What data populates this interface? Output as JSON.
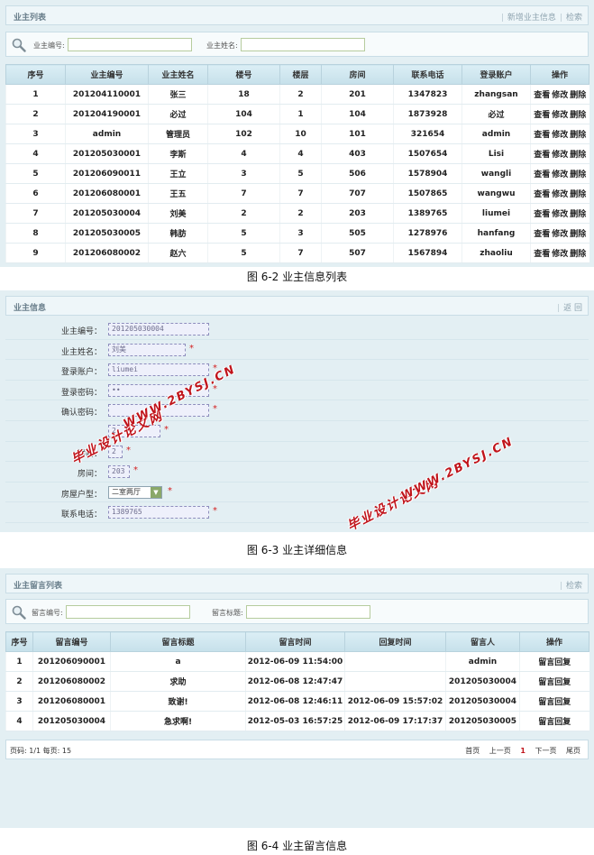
{
  "owner_list": {
    "title": "业主列表",
    "links": [
      "新增业主信息",
      "检索"
    ],
    "search": {
      "label1": "业主编号:",
      "label2": "业主姓名:"
    },
    "columns": [
      "序号",
      "业主编号",
      "业主姓名",
      "楼号",
      "楼层",
      "房间",
      "联系电话",
      "登录账户",
      "操作"
    ],
    "actions": [
      "查看",
      "修改",
      "删除"
    ],
    "rows": [
      [
        "1",
        "201204110001",
        "张三",
        "18",
        "2",
        "201",
        "1347823",
        "zhangsan"
      ],
      [
        "2",
        "201204190001",
        "必过",
        "104",
        "1",
        "104",
        "1873928",
        "必过"
      ],
      [
        "3",
        "admin",
        "管理员",
        "102",
        "10",
        "101",
        "321654",
        "admin"
      ],
      [
        "4",
        "201205030001",
        "李斯",
        "4",
        "4",
        "403",
        "1507654",
        "Lisi"
      ],
      [
        "5",
        "201206090011",
        "王立",
        "3",
        "5",
        "506",
        "1578904",
        "wangli"
      ],
      [
        "6",
        "201206080001",
        "王五",
        "7",
        "7",
        "707",
        "1507865",
        "wangwu"
      ],
      [
        "7",
        "201205030004",
        "刘美",
        "2",
        "2",
        "203",
        "1389765",
        "liumei"
      ],
      [
        "8",
        "201205030005",
        "韩肪",
        "5",
        "3",
        "505",
        "1278976",
        "hanfang"
      ],
      [
        "9",
        "201206080002",
        "赵六",
        "5",
        "7",
        "507",
        "1567894",
        "zhaoliu"
      ]
    ],
    "caption": "图 6-2  业主信息列表"
  },
  "owner_info": {
    "title": "业主信息",
    "back": "返 回",
    "fields": [
      {
        "label": "业主编号：",
        "value": "201205030004",
        "required": false
      },
      {
        "label": "业主姓名：",
        "value": "刘美",
        "required": true
      },
      {
        "label": "登录账户：",
        "value": "liumei",
        "required": true
      },
      {
        "label": "登录密码：",
        "value": "••",
        "required": true
      },
      {
        "label": "确认密码：",
        "value": "",
        "required": true
      },
      {
        "label": "",
        "value": "2",
        "required": true
      },
      {
        "label": "楼层：",
        "value": "2",
        "required": true
      },
      {
        "label": "房间：",
        "value": "203",
        "required": true
      },
      {
        "label": "房屋户型：",
        "value": "二室两厅",
        "required": true
      },
      {
        "label": "联系电话：",
        "value": "1389765",
        "required": true
      }
    ],
    "watermark1": "毕业设计论文网",
    "watermark2": "WWW.2BYSJ.CN",
    "caption": "图 6-3  业主详细信息"
  },
  "messages": {
    "title": "业主留言列表",
    "links": [
      "检索"
    ],
    "search": {
      "label1": "留言编号:",
      "label2": "留言标题:"
    },
    "columns": [
      "序号",
      "留言编号",
      "留言标题",
      "留言时间",
      "回复时间",
      "留言人",
      "操作"
    ],
    "action": "留言回复",
    "rows": [
      [
        "1",
        "201206090001",
        "a",
        "2012-06-09 11:54:00",
        "",
        "admin"
      ],
      [
        "2",
        "201206080002",
        "求助",
        "2012-06-08 12:47:47",
        "",
        "201205030004"
      ],
      [
        "3",
        "201206080001",
        "致谢!",
        "2012-06-08 12:46:11",
        "2012-06-09 15:57:02",
        "201205030004"
      ],
      [
        "4",
        "201205030004",
        "急求啊!",
        "2012-05-03 16:57:25",
        "2012-06-09 17:17:37",
        "201205030005"
      ]
    ],
    "pager": {
      "left": "页码:   1/1 每页: 15",
      "first": "首页",
      "prev": "上一页",
      "current": "1",
      "next": "下一页",
      "last": "尾页"
    },
    "caption": "图 6-4  业主留言信息"
  }
}
